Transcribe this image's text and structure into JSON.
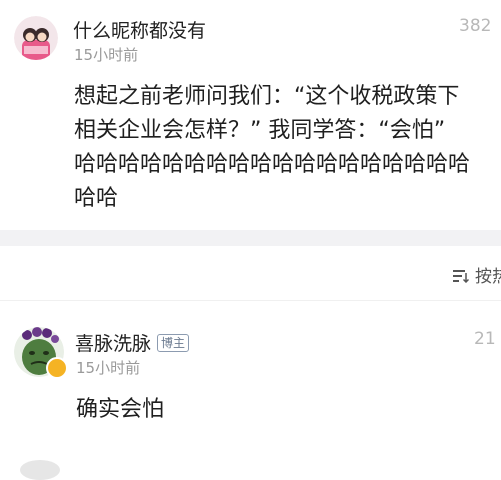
{
  "comment1": {
    "username": "什么昵称都没有",
    "time": "15小时前",
    "likes": "382",
    "text_lines": [
      "想起之前老师问我们：“这个收税政策下",
      "相关企业会怎样？”  我同学答：“会怕”",
      "哈哈哈哈哈哈哈哈哈哈哈哈哈哈哈哈哈哈",
      "哈哈"
    ]
  },
  "sort": {
    "label": "按热"
  },
  "comment2": {
    "username": "喜脉洗脉",
    "badge": "博主",
    "time": "15小时前",
    "likes": "21",
    "text": "确实会怕"
  },
  "colors": {
    "divider": "#f2f2f4",
    "secondary_text": "#9a9a9a",
    "verified_badge": "#f5b324"
  }
}
